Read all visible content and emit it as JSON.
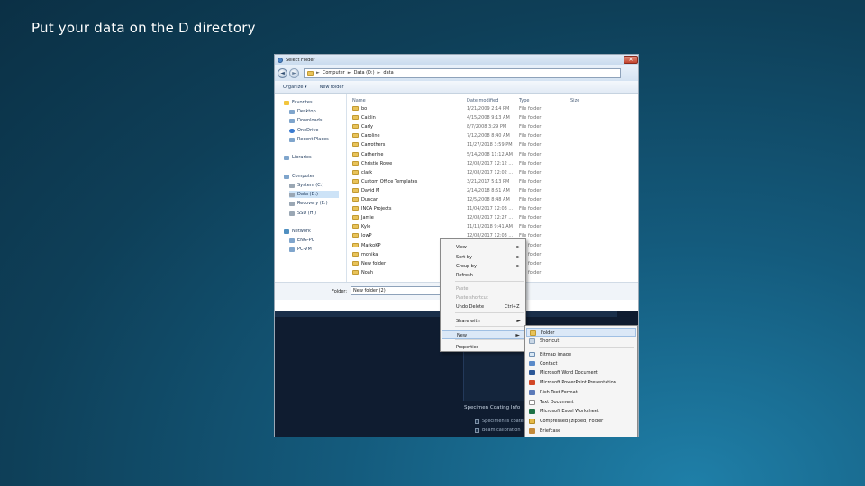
{
  "slide": {
    "title": "Put your data on the D directory"
  },
  "window": {
    "title": "Select Folder",
    "breadcrumb": [
      "Computer",
      "Data (D:)",
      "data"
    ]
  },
  "toolbar": {
    "organize": "Organize ▾",
    "new_folder": "New folder"
  },
  "nav": [
    {
      "label": "Favorites",
      "icon": "star-icon"
    },
    {
      "label": "Desktop",
      "icon": "desktop-icon"
    },
    {
      "label": "Downloads",
      "icon": "downloads-icon"
    },
    {
      "label": "OneDrive",
      "icon": "cloud-icon"
    },
    {
      "label": "Recent Places",
      "icon": "recent-icon"
    },
    {
      "label": "Libraries",
      "icon": "library-icon"
    },
    {
      "label": "Computer",
      "icon": "computer-icon"
    },
    {
      "label": "System (C:)",
      "icon": "drive-icon"
    },
    {
      "label": "Data (D:)",
      "icon": "drive-icon"
    },
    {
      "label": "Recovery (E:)",
      "icon": "drive-icon"
    },
    {
      "label": "SSD (H:)",
      "icon": "drive-icon"
    },
    {
      "label": "Network",
      "icon": "network-icon"
    },
    {
      "label": "ENG-PC",
      "icon": "pc-icon"
    },
    {
      "label": "PC-VM",
      "icon": "pc-icon"
    }
  ],
  "columns": {
    "name": "Name",
    "date": "Date modified",
    "type": "Type",
    "size": "Size"
  },
  "files": [
    {
      "name": "bo",
      "date": "1/21/2009 2:14 PM",
      "type": "File folder"
    },
    {
      "name": "Caitlin",
      "date": "4/15/2008 9:13 AM",
      "type": "File folder"
    },
    {
      "name": "Carly",
      "date": "8/7/2008 3:29 PM",
      "type": "File folder"
    },
    {
      "name": "Caroline",
      "date": "7/12/2008 8:40 AM",
      "type": "File folder"
    },
    {
      "name": "Carrothers",
      "date": "11/27/2018 3:59 PM",
      "type": "File folder"
    },
    {
      "name": "Catherine",
      "date": "5/14/2008 11:12 AM",
      "type": "File folder"
    },
    {
      "name": "Christie Rowe",
      "date": "12/08/2017 12:12 ...",
      "type": "File folder"
    },
    {
      "name": "clark",
      "date": "12/08/2017 12:02 ...",
      "type": "File folder"
    },
    {
      "name": "Custom Office Templates",
      "date": "3/21/2017 5:13 PM",
      "type": "File folder"
    },
    {
      "name": "David M",
      "date": "2/14/2018 8:51 AM",
      "type": "File folder"
    },
    {
      "name": "Duncan",
      "date": "12/5/2008 8:48 AM",
      "type": "File folder"
    },
    {
      "name": "INCA Projects",
      "date": "11/04/2017 12:03 ...",
      "type": "File folder"
    },
    {
      "name": "Jamie",
      "date": "12/08/2017 12:27 ...",
      "type": "File folder"
    },
    {
      "name": "Kyle",
      "date": "11/13/2018 9:41 AM",
      "type": "File folder"
    },
    {
      "name": "lowP",
      "date": "12/08/2017 12:03 ...",
      "type": "File folder"
    },
    {
      "name": "MarkoKP",
      "date": "",
      "type": "File folder"
    },
    {
      "name": "monika",
      "date": "",
      "type": "File folder"
    },
    {
      "name": "New folder",
      "date": "",
      "type": "File folder"
    },
    {
      "name": "Noah",
      "date": "",
      "type": "File folder"
    }
  ],
  "folder_bar": {
    "label": "Folder:",
    "value": "New folder (2)"
  },
  "context_menu": [
    {
      "label": "View",
      "arrow": "►"
    },
    {
      "label": "Sort by",
      "arrow": "►"
    },
    {
      "label": "Group by",
      "arrow": "►"
    },
    {
      "label": "Refresh"
    },
    {
      "label": "Paste",
      "disabled": true
    },
    {
      "label": "Paste shortcut",
      "disabled": true
    },
    {
      "label": "Undo Delete",
      "shortcut": "Ctrl+Z"
    },
    {
      "label": "Share with",
      "arrow": "►"
    },
    {
      "label": "New",
      "arrow": "►"
    },
    {
      "label": "Properties"
    }
  ],
  "new_submenu": [
    {
      "label": "Folder",
      "icon": "folder-icon"
    },
    {
      "label": "Shortcut",
      "icon": "shortcut-icon"
    },
    {
      "label": "Bitmap image",
      "icon": "bitmap-icon"
    },
    {
      "label": "Contact",
      "icon": "contact-icon"
    },
    {
      "label": "Microsoft Word Document",
      "icon": "word-icon"
    },
    {
      "label": "Microsoft PowerPoint Presentation",
      "icon": "powerpoint-icon"
    },
    {
      "label": "Rich Text Format",
      "icon": "rtf-icon"
    },
    {
      "label": "Text Document",
      "icon": "text-icon"
    },
    {
      "label": "Microsoft Excel Worksheet",
      "icon": "excel-icon"
    },
    {
      "label": "Compressed (zipped) Folder",
      "icon": "zip-icon"
    },
    {
      "label": "Briefcase",
      "icon": "briefcase-icon"
    }
  ],
  "background_app": {
    "section": "Specimen Coating Info",
    "checks": [
      "Specimen is coated",
      "Beam calibration"
    ]
  }
}
